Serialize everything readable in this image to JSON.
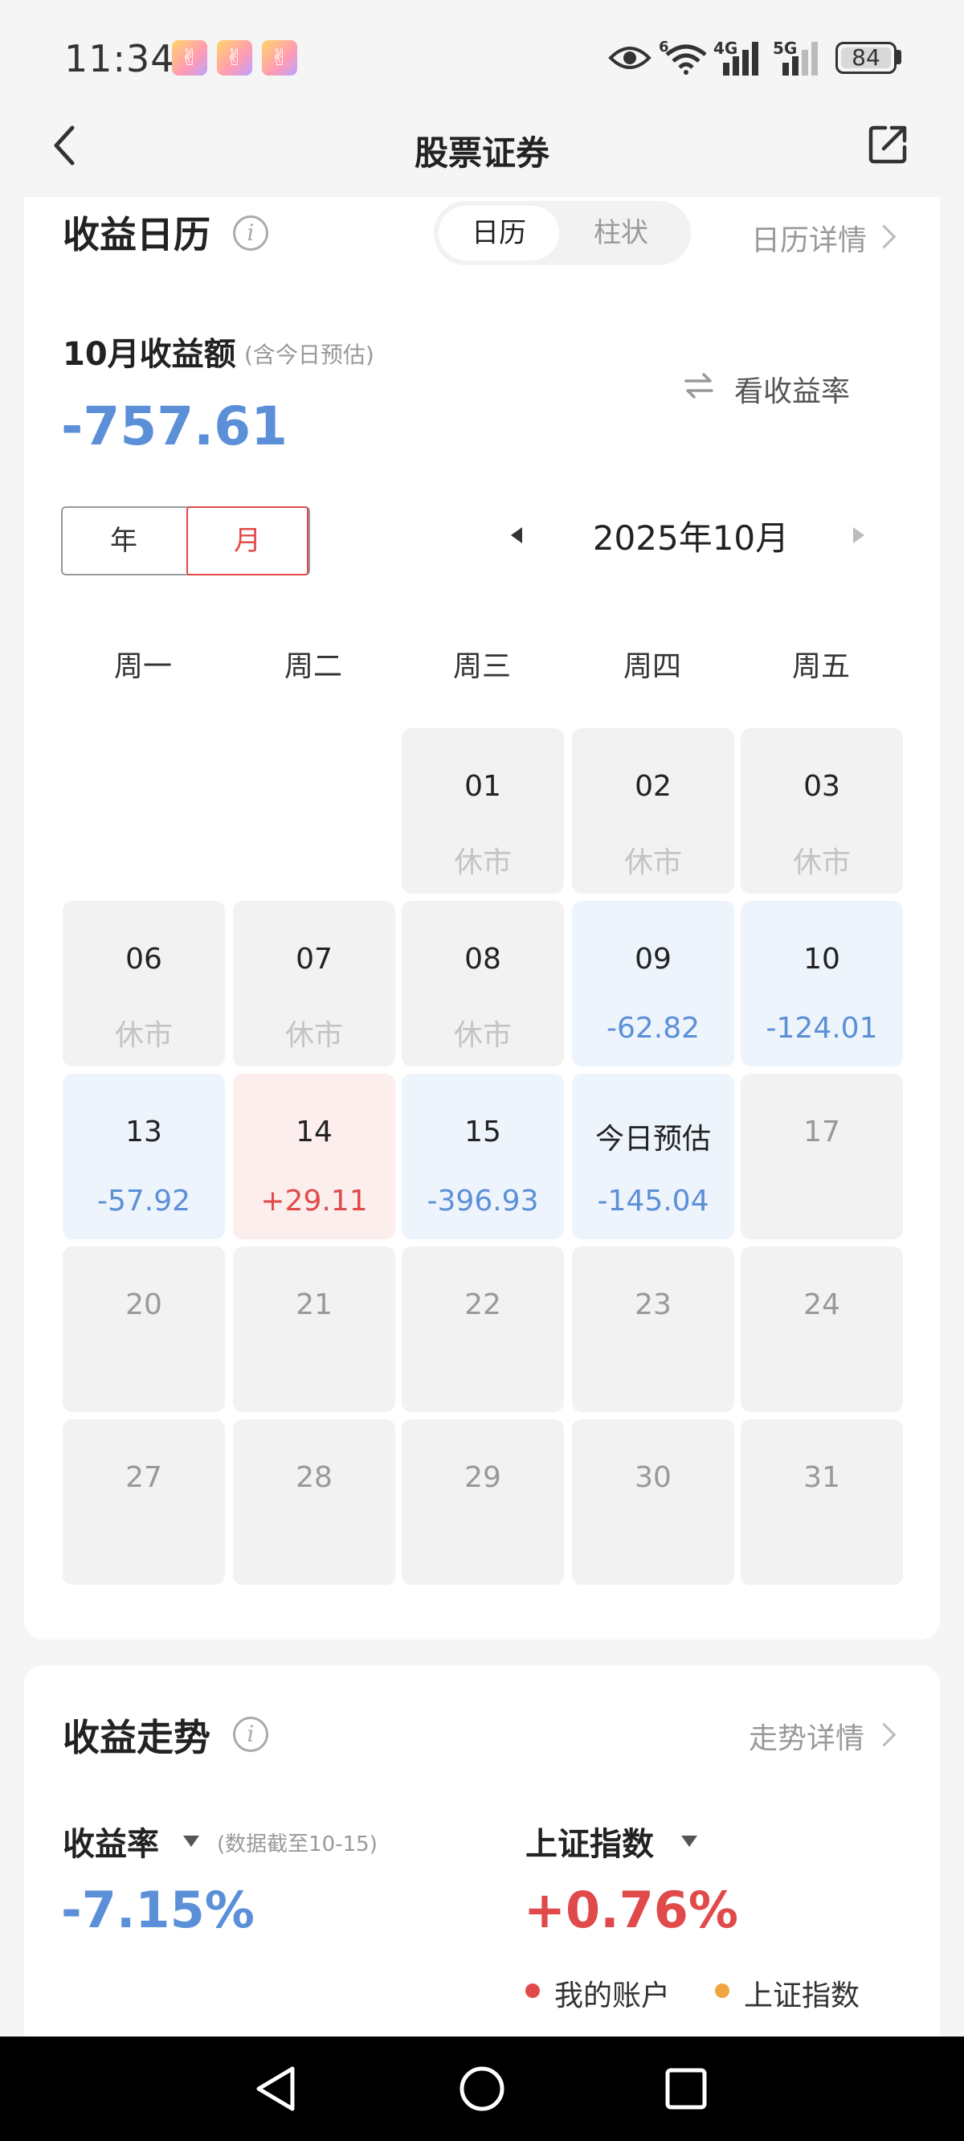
{
  "status_bar": {
    "time": "11:34",
    "network_1": "4G",
    "network_2": "5G",
    "wifi_badge": "6",
    "battery": "84"
  },
  "nav": {
    "title": "股票证券"
  },
  "calendar_section": {
    "title": "收益日历",
    "view_tabs": [
      "日历",
      "柱状"
    ],
    "active_tab": "日历",
    "detail_link": "日历详情",
    "month_label": "10月收益额",
    "month_note": "(含今日预估)",
    "total": "-757.61",
    "switch_label": "看收益率",
    "period_toggle": [
      "年",
      "月"
    ],
    "active_period": "月",
    "current_month": "2025年10月",
    "weekdays": [
      "周一",
      "周二",
      "周三",
      "周四",
      "周五"
    ],
    "days": [
      {
        "date": "01",
        "value": "休市",
        "state": "closed"
      },
      {
        "date": "02",
        "value": "休市",
        "state": "closed"
      },
      {
        "date": "03",
        "value": "休市",
        "state": "closed"
      },
      {
        "date": "06",
        "value": "休市",
        "state": "closed"
      },
      {
        "date": "07",
        "value": "休市",
        "state": "closed"
      },
      {
        "date": "08",
        "value": "休市",
        "state": "closed"
      },
      {
        "date": "09",
        "value": "-62.82",
        "state": "loss"
      },
      {
        "date": "10",
        "value": "-124.01",
        "state": "loss"
      },
      {
        "date": "13",
        "value": "-57.92",
        "state": "loss"
      },
      {
        "date": "14",
        "value": "+29.11",
        "state": "gain"
      },
      {
        "date": "15",
        "value": "-396.93",
        "state": "loss"
      },
      {
        "date": "今日预估",
        "value": "-145.04",
        "state": "loss"
      },
      {
        "date": "17",
        "value": "",
        "state": "future"
      },
      {
        "date": "20",
        "value": "",
        "state": "future"
      },
      {
        "date": "21",
        "value": "",
        "state": "future"
      },
      {
        "date": "22",
        "value": "",
        "state": "future"
      },
      {
        "date": "23",
        "value": "",
        "state": "future"
      },
      {
        "date": "24",
        "value": "",
        "state": "future"
      },
      {
        "date": "27",
        "value": "",
        "state": "future"
      },
      {
        "date": "28",
        "value": "",
        "state": "future"
      },
      {
        "date": "29",
        "value": "",
        "state": "future"
      },
      {
        "date": "30",
        "value": "",
        "state": "future"
      },
      {
        "date": "31",
        "value": "",
        "state": "future"
      }
    ]
  },
  "trend_section": {
    "title": "收益走势",
    "detail_link": "走势详情",
    "rate_label": "收益率",
    "rate_note": "(数据截至10-15)",
    "rate_value": "-7.15%",
    "index_label": "上证指数",
    "index_value": "+0.76%",
    "legend": [
      {
        "label": "我的账户",
        "color": "#e04a4a"
      },
      {
        "label": "上证指数",
        "color": "#f0a640"
      }
    ]
  },
  "colors": {
    "loss": "#5b8fd8",
    "gain": "#e04a4a"
  }
}
